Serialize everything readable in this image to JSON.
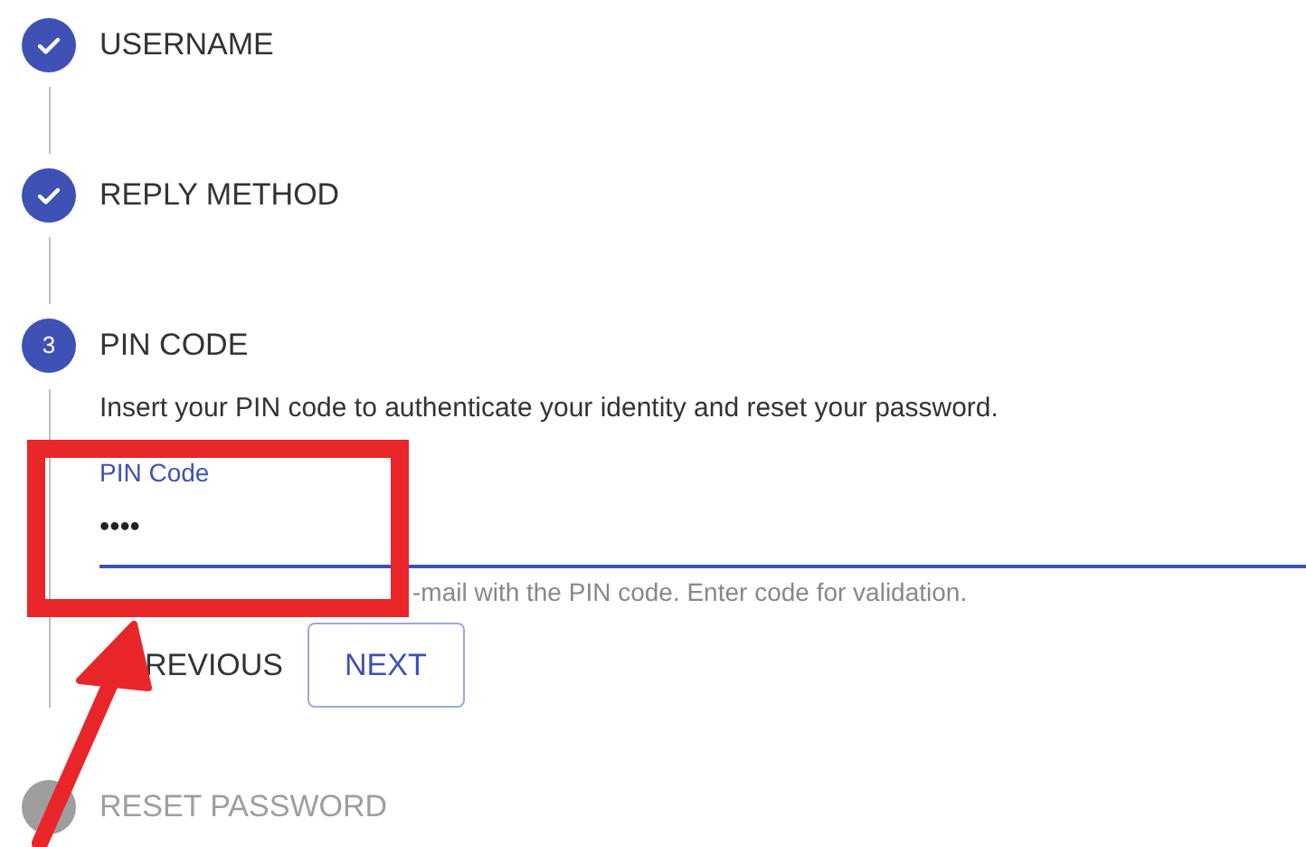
{
  "steps": [
    {
      "label": "USERNAME",
      "done": true,
      "active": false
    },
    {
      "label": "REPLY METHOD",
      "done": true,
      "active": false
    },
    {
      "label": "PIN CODE",
      "done": false,
      "active": true,
      "number": "3",
      "content": {
        "description": "Insert your PIN code to authenticate your identity and reset your password.",
        "field": {
          "label": "PIN Code",
          "value": "••••"
        },
        "helper": "-mail with the PIN code. Enter code for validation.",
        "buttons": [
          {
            "label": "REVIOUS",
            "kind": "text"
          },
          {
            "label": "NEXT",
            "kind": "outlined"
          }
        ]
      }
    },
    {
      "label": "RESET PASSWORD",
      "done": false,
      "active": false
    }
  ],
  "annotations": {
    "highlight_box": true,
    "arrow": true
  }
}
